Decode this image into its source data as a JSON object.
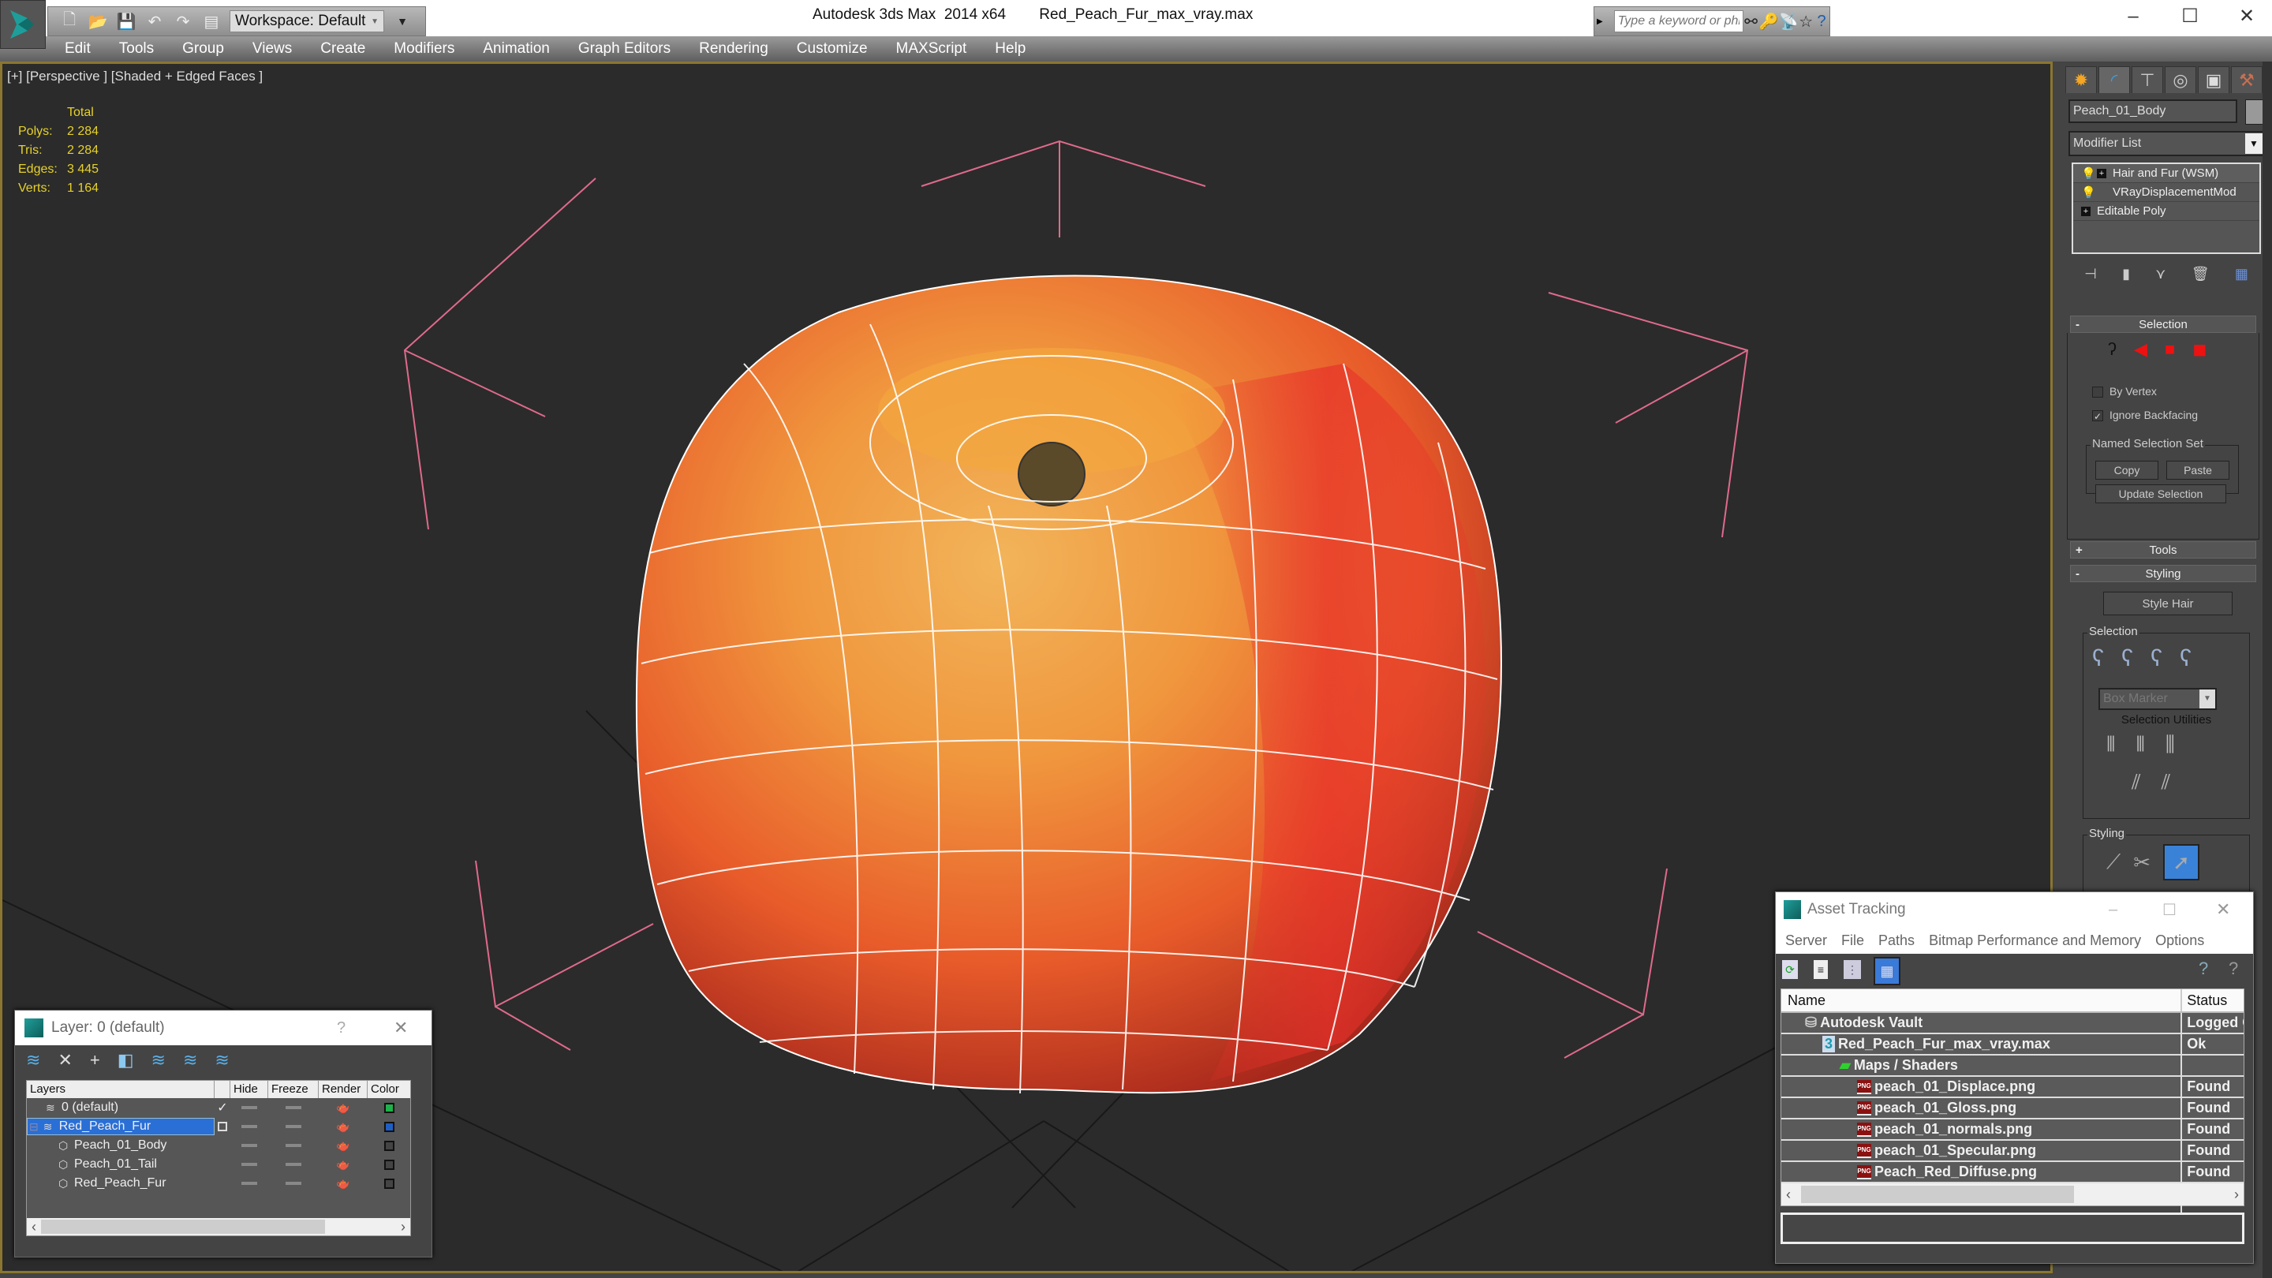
{
  "titlebar": {
    "app_name": "Autodesk 3ds Max  2014 x64",
    "file_name": "Red_Peach_Fur_max_vray.max",
    "workspace": "Workspace: Default",
    "search_placeholder": "Type a keyword or phrase",
    "window_controls": {
      "minimize": "–",
      "maximize": "☐",
      "close": "✕"
    }
  },
  "menu": [
    "Edit",
    "Tools",
    "Group",
    "Views",
    "Create",
    "Modifiers",
    "Animation",
    "Graph Editors",
    "Rendering",
    "Customize",
    "MAXScript",
    "Help"
  ],
  "viewport": {
    "label": "[+] [Perspective ] [Shaded + Edged Faces ]",
    "stats": {
      "header": "Total",
      "rows": [
        {
          "label": "Polys:",
          "value": "2 284"
        },
        {
          "label": "Tris:",
          "value": "2 284"
        },
        {
          "label": "Edges:",
          "value": "3 445"
        },
        {
          "label": "Verts:",
          "value": "1 164"
        }
      ]
    },
    "colors": {
      "background": "#2b2b2b",
      "frame": "#8a7630",
      "gizmo": "#e06a8c",
      "wire": "#ffffff",
      "stat_text": "#e6d12a"
    }
  },
  "command_panel": {
    "tabs": [
      "create",
      "modify",
      "hierarchy",
      "motion",
      "display",
      "utilities"
    ],
    "object_name": "Peach_01_Body",
    "modifier_list": "Modifier List",
    "stack": [
      {
        "label": "Hair and Fur (WSM)",
        "bulb": true,
        "expand": true
      },
      {
        "label": "VRayDisplacementMod",
        "bulb": true,
        "expand": false
      },
      {
        "label": "Editable Poly",
        "bulb": false,
        "expand": true
      }
    ],
    "selection_rollout": {
      "title": "Selection",
      "by_vertex": "By Vertex",
      "by_vertex_checked": false,
      "ignore_backfacing": "Ignore Backfacing",
      "ignore_backfacing_checked": true,
      "named_set": "Named Selection Set",
      "copy": "Copy",
      "paste": "Paste",
      "update": "Update Selection"
    },
    "tools_rollout": "Tools",
    "styling_rollout": {
      "title": "Styling",
      "style_hair": "Style Hair",
      "selection_group": "Selection",
      "marker": "Box Marker",
      "selection_utilities": "Selection Utilities",
      "styling_group": "Styling"
    }
  },
  "layer_dialog": {
    "title": "Layer: 0 (default)",
    "help": "?",
    "close": "✕",
    "columns": [
      "Layers",
      "",
      "Hide",
      "Freeze",
      "Render",
      "Color"
    ],
    "rows": [
      {
        "name": "0 (default)",
        "level": 0,
        "type": "layer",
        "current": "✓",
        "color": "#1db34a",
        "selected": false
      },
      {
        "name": "Red_Peach_Fur",
        "level": 0,
        "type": "layer",
        "current": "",
        "color": "#1f5fc4",
        "selected": true
      },
      {
        "name": "Peach_01_Body",
        "level": 1,
        "type": "object",
        "current": "",
        "color": "#444444",
        "selected": false
      },
      {
        "name": "Peach_01_Tail",
        "level": 1,
        "type": "object",
        "current": "",
        "color": "#444444",
        "selected": false
      },
      {
        "name": "Red_Peach_Fur",
        "level": 1,
        "type": "object",
        "current": "",
        "color": "#444444",
        "selected": false
      }
    ],
    "scroll_left": "‹",
    "scroll_right": "›"
  },
  "asset_dialog": {
    "title": "Asset Tracking",
    "menu": [
      "Server",
      "File",
      "Paths",
      "Bitmap Performance and Memory",
      "Options"
    ],
    "columns": [
      "Name",
      "Status"
    ],
    "rows": [
      {
        "name": "Autodesk Vault",
        "status": "Logged Out",
        "level": 0,
        "icon": "vault"
      },
      {
        "name": "Red_Peach_Fur_max_vray.max",
        "status": "Ok",
        "level": 1,
        "icon": "max"
      },
      {
        "name": "Maps / Shaders",
        "status": "",
        "level": 2,
        "icon": "maps"
      },
      {
        "name": "peach_01_Displace.png",
        "status": "Found",
        "level": 3,
        "icon": "png"
      },
      {
        "name": "peach_01_Gloss.png",
        "status": "Found",
        "level": 3,
        "icon": "png"
      },
      {
        "name": "peach_01_normals.png",
        "status": "Found",
        "level": 3,
        "icon": "png"
      },
      {
        "name": "peach_01_Specular.png",
        "status": "Found",
        "level": 3,
        "icon": "png"
      },
      {
        "name": "Peach_Red_Diffuse.png",
        "status": "Found",
        "level": 3,
        "icon": "png"
      },
      {
        "name": "",
        "status": "",
        "level": 0,
        "icon": ""
      },
      {
        "name": "",
        "status": "",
        "level": 0,
        "icon": ""
      }
    ],
    "png_label": "PNG",
    "scroll_left": "‹",
    "scroll_right": "›"
  }
}
